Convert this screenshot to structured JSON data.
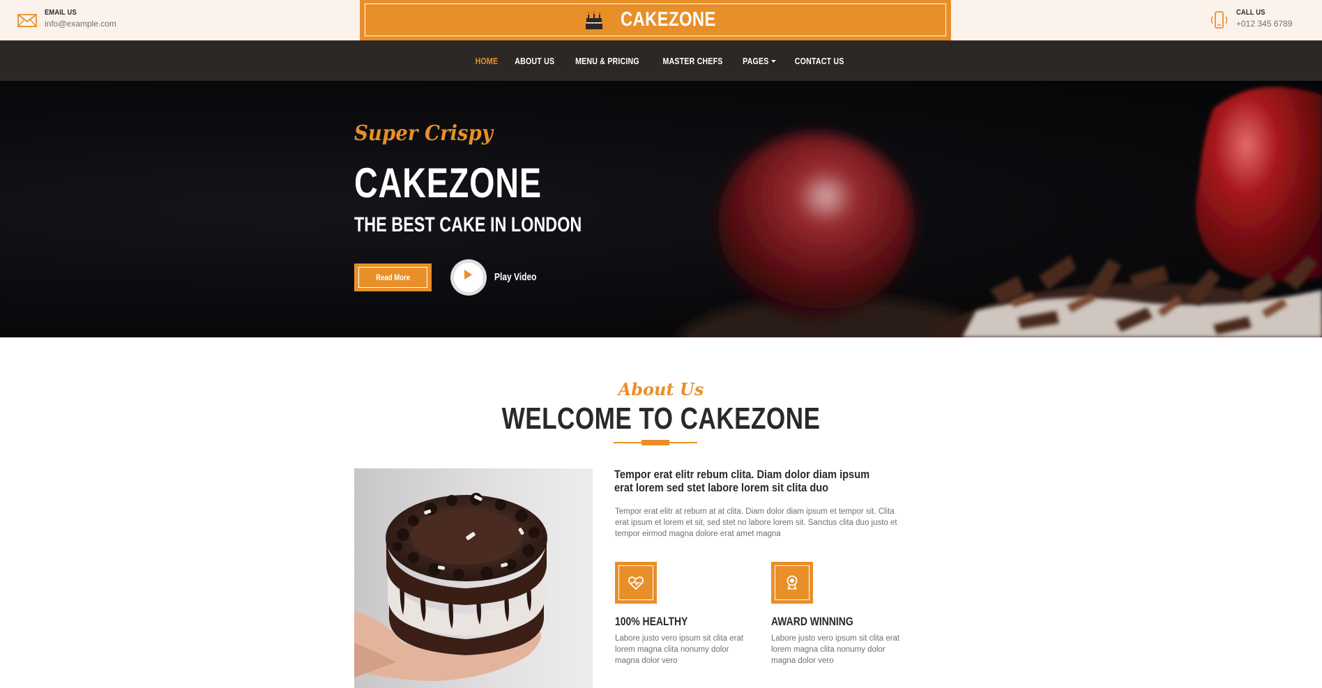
{
  "topbar": {
    "email": {
      "label": "EMAIL US",
      "value": "info@example.com",
      "icon": "envelope-icon"
    },
    "call": {
      "label": "CALL US",
      "value": "+012 345 6789",
      "icon": "phone-icon"
    },
    "logo": {
      "text": "CAKEZONE",
      "icon": "birthday-cake-icon"
    }
  },
  "nav": {
    "items": [
      {
        "label": "HOME",
        "active": true
      },
      {
        "label": "ABOUT US",
        "active": false
      },
      {
        "label": "MENU & PRICING",
        "active": false
      },
      {
        "label": "MASTER CHEFS",
        "active": false
      },
      {
        "label": "PAGES",
        "active": false,
        "dropdown": true
      },
      {
        "label": "CONTACT US",
        "active": false
      }
    ]
  },
  "hero": {
    "kicker": "Super Crispy",
    "title": "CAKEZONE",
    "subtitle": "THE BEST CAKE IN LONDON",
    "read_more": "Read More",
    "play_label": "Play Video",
    "play_icon": "play-icon"
  },
  "about": {
    "kicker": "About Us",
    "title": "WELCOME TO CAKEZONE",
    "lead": "Tempor erat elitr rebum clita. Diam dolor diam ipsum erat lorem sed stet labore lorem sit clita duo",
    "body": "Tempor erat elitr at rebum at at clita. Diam dolor diam ipsum et tempor sit. Clita erat ipsum et lorem et sit, sed stet no labore lorem sit. Sanctus clita duo justo et tempor eirmod magna dolore erat amet magna",
    "features": [
      {
        "icon": "heart-pulse-icon",
        "title": "100% HEALTHY",
        "text": "Labore justo vero ipsum sit clita erat lorem magna clita nonumy dolor magna dolor vero"
      },
      {
        "icon": "award-icon",
        "title": "AWARD WINNING",
        "text": "Labore justo vero ipsum sit clita erat lorem magna clita nonumy dolor magna dolor vero"
      }
    ]
  },
  "colors": {
    "primary": "#e88f2a",
    "dark": "#2b2825",
    "topbar_bg": "#fbf2ec",
    "text_muted": "#6f6f6f"
  }
}
